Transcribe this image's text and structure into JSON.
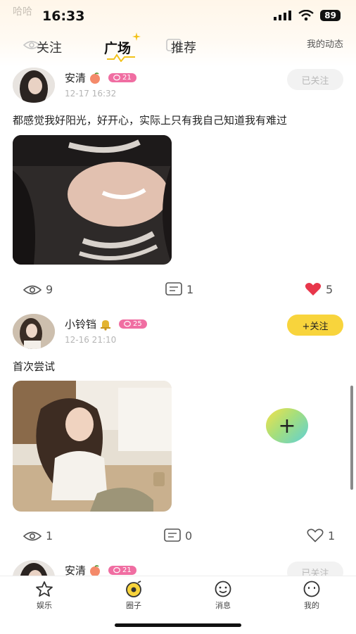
{
  "status": {
    "ghost_text": "哈哈",
    "time": "16:33",
    "battery": "89"
  },
  "tabs": {
    "items": [
      "关注",
      "广场",
      "推荐"
    ],
    "active": "广场",
    "my_activity": "我的动态"
  },
  "posts": [
    {
      "user": "安清",
      "level": "21",
      "time": "12-17 16:32",
      "follow_label": "已关注",
      "text": "都感觉我好阳光，好开心，实际上只有我自己知道我有难过",
      "views": "9",
      "comments": "1",
      "likes": "5",
      "liked": true
    },
    {
      "user": "小铃铛",
      "level": "25",
      "time": "12-16 21:10",
      "follow_label": "+关注",
      "text": "首次尝试",
      "views": "1",
      "comments": "0",
      "likes": "1",
      "liked": false
    },
    {
      "user": "安清",
      "level": "21",
      "follow_label": "已关注"
    }
  ],
  "fab": {
    "label": "+"
  },
  "bottom_nav": {
    "items": [
      "娱乐",
      "圈子",
      "消息",
      "我的"
    ],
    "active": "圈子"
  }
}
